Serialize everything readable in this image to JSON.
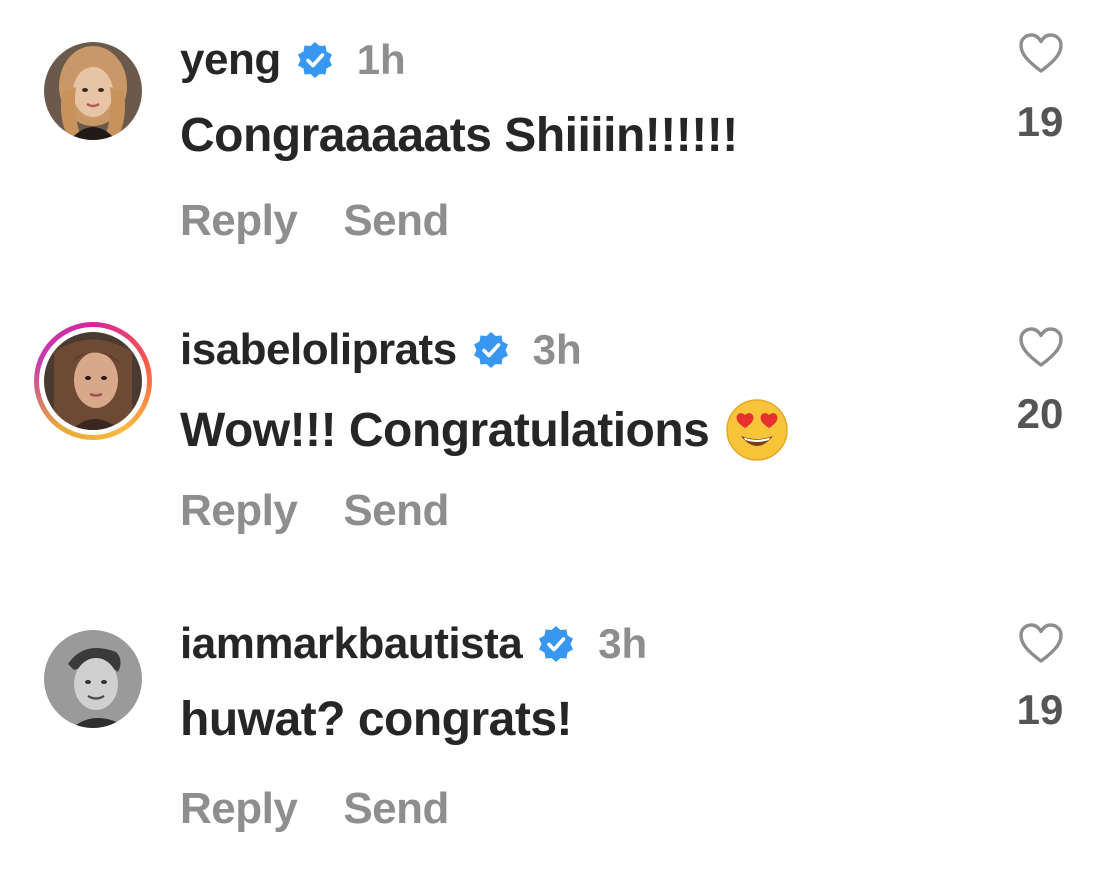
{
  "colors": {
    "text_primary": "#262626",
    "text_secondary": "#8e8e8e",
    "verified_blue": "#3897f0",
    "story_ring": "#d6249f"
  },
  "comments": [
    {
      "username": "yeng",
      "verified": true,
      "timestamp": "1h",
      "text": "Congraaaaats Shiiiin!!!!!!",
      "emoji": "",
      "reply_label": "Reply",
      "send_label": "Send",
      "likes": "19",
      "like_icon": "heart-outline-icon",
      "has_story_ring": false
    },
    {
      "username": "isabeloliprats",
      "verified": true,
      "timestamp": "3h",
      "text": "Wow!!! Congratulations",
      "emoji": "heart-eyes-emoji",
      "reply_label": "Reply",
      "send_label": "Send",
      "likes": "20",
      "like_icon": "heart-outline-icon",
      "has_story_ring": true
    },
    {
      "username": "iammarkbautista",
      "verified": true,
      "timestamp": "3h",
      "text": "huwat? congrats!",
      "emoji": "",
      "reply_label": "Reply",
      "send_label": "Send",
      "likes": "19",
      "like_icon": "heart-outline-icon",
      "has_story_ring": false
    }
  ]
}
